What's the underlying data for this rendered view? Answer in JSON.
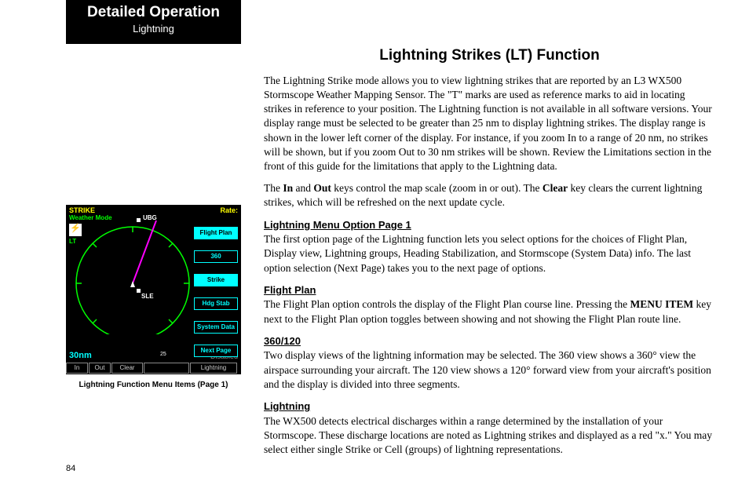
{
  "header": {
    "title": "Detailed Operation",
    "subtitle": "Lightning"
  },
  "figure": {
    "top_left": "STRIKE",
    "weather_mode": "Weather Mode",
    "lt_symbol": "⚡",
    "lt_label": "LT",
    "top_right": "Rate:",
    "waypoint1": "UBG",
    "waypoint2": "SLE",
    "range": "30nm",
    "range_tick": "25",
    "disabled": "Disabled",
    "menu": [
      "Flight Plan",
      "360",
      "Strike",
      "Hdg Stab",
      "System Data",
      "Next Page"
    ],
    "bottom_buttons": [
      "In",
      "Out",
      "Clear",
      "",
      "Lightning"
    ],
    "caption": "Lightning Function Menu Items (Page 1)"
  },
  "main": {
    "heading": "Lightning Strikes (LT) Function",
    "para1": "The Lightning Strike mode allows you to view lightning strikes that are reported by an L3 WX500 Stormscope Weather Mapping Sensor. The \"T\" marks are used as reference marks to aid in locating strikes in reference to your position. The Lightning function is not available in all software versions. Your display range must be selected to be greater than 25 nm to display lightning strikes. The display range is shown in the lower left corner of the display. For instance, if you zoom In to a range of 20 nm, no strikes will be shown, but if you zoom Out to 30 nm strikes will be shown. Review the Limitations section in the front of this guide for the limitations that apply to the Lightning data.",
    "para2_pre": "The ",
    "para2_b1": "In",
    "para2_mid1": " and ",
    "para2_b2": "Out",
    "para2_mid2": " keys control the map scale (zoom in or out). The ",
    "para2_b3": "Clear",
    "para2_post": " key clears the current lightning strikes, which will be refreshed on the next update cycle.",
    "sections": [
      {
        "heading": "Lightning Menu Option Page 1",
        "body_pre": "The first option page of the Lightning function lets you select options for the choices of Flight Plan, Display view, Lightning groups, Heading Stabilization, and Stormscope (System Data) info. The last option selection (Next Page) takes you to the next page of options.",
        "bold": "",
        "body_post": ""
      },
      {
        "heading": "Flight Plan",
        "body_pre": "The Flight Plan option controls the display of the Flight Plan course line. Pressing the ",
        "bold": "MENU ITEM",
        "body_post": " key next to the Flight Plan option toggles between showing and not showing the Flight Plan route line."
      },
      {
        "heading": "360/120",
        "body_pre": "Two display views of the lightning information may be selected. The 360 view shows a 360° view the airspace surrounding your aircraft. The 120 view shows a 120° forward view from your aircraft's position and the display is divided into three segments.",
        "bold": "",
        "body_post": ""
      },
      {
        "heading": "Lightning",
        "body_pre": "The WX500 detects electrical discharges within a range determined by the installation of your Stormscope. These discharge locations are noted as Lightning strikes and displayed as a red \"x.\" You may select either single Strike or Cell (groups) of lightning representations.",
        "bold": "",
        "body_post": ""
      }
    ]
  },
  "page_number": "84"
}
